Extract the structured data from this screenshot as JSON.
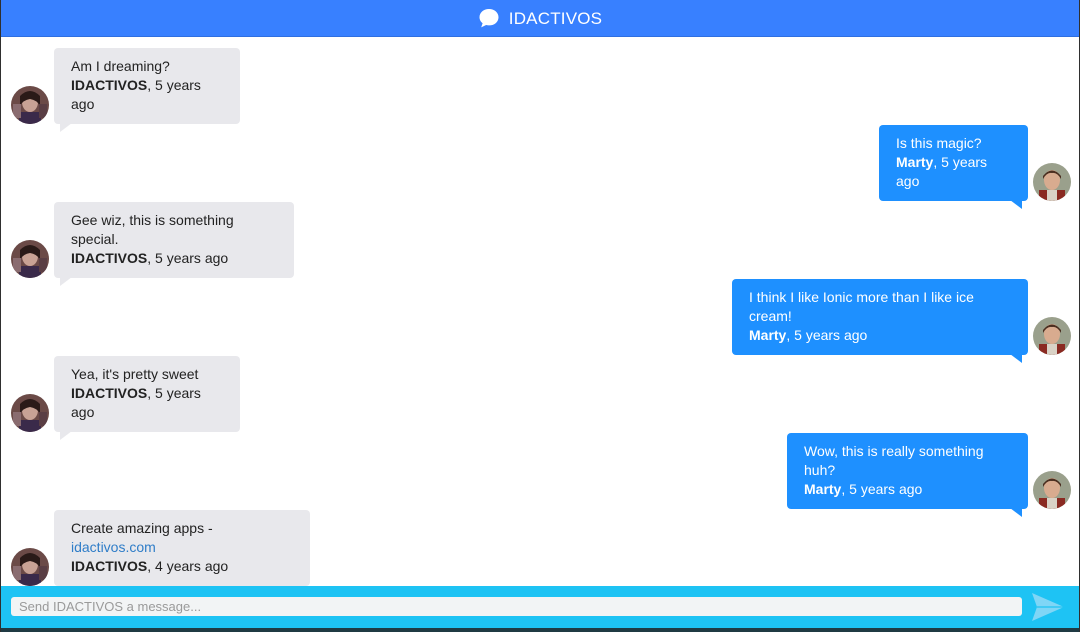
{
  "header": {
    "title": "IDACTIVOS"
  },
  "messages": [
    {
      "side": "incoming",
      "text": "Am I dreaming?",
      "author": "IDACTIVOS",
      "time": ", 5 years ago"
    },
    {
      "side": "outgoing",
      "text": "Is this magic?",
      "author": "Marty",
      "time": ", 5 years ago"
    },
    {
      "side": "incoming",
      "text": "Gee wiz, this is something special.",
      "author": "IDACTIVOS",
      "time": ", 5 years ago"
    },
    {
      "side": "outgoing",
      "text": "I think I like Ionic more than I like ice cream!",
      "author": "Marty",
      "time": ", 5 years ago"
    },
    {
      "side": "incoming",
      "text": "Yea, it's pretty sweet",
      "author": "IDACTIVOS",
      "time": ", 5 years ago"
    },
    {
      "side": "outgoing",
      "text": "Wow, this is really something huh?",
      "author": "Marty",
      "time": ", 5 years ago"
    },
    {
      "side": "incoming",
      "text": "Create amazing apps - ",
      "link": "idactivos.com",
      "author": "IDACTIVOS",
      "time": ", 4 years ago"
    }
  ],
  "composer": {
    "placeholder": "Send IDACTIVOS a message...",
    "value": ""
  },
  "colors": {
    "header": "#3880ff",
    "incoming_bubble": "#e8e8ec",
    "outgoing_bubble": "#1e90ff",
    "footer": "#1ec3f4",
    "send_icon": "#7fd6f6",
    "link": "#2f7dc8"
  },
  "icons": {
    "header": "chat-bubble-icon",
    "send": "send-icon"
  }
}
